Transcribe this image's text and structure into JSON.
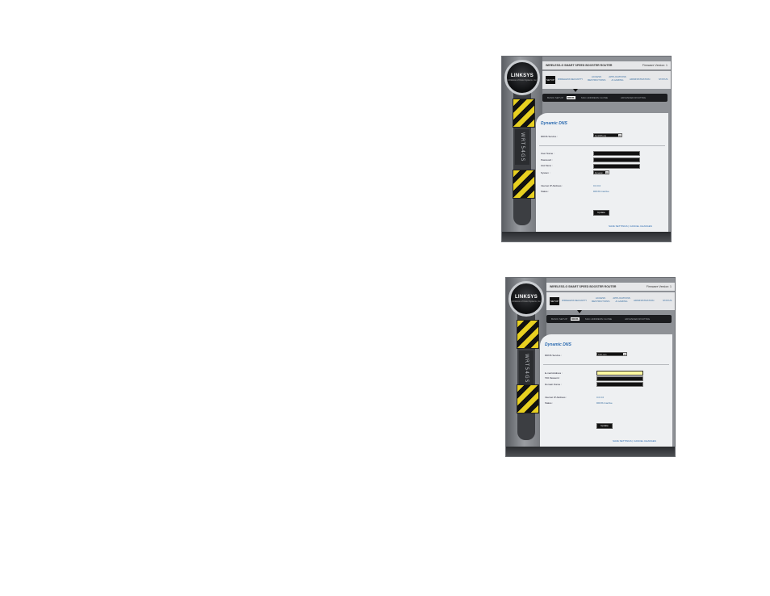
{
  "shots": [
    {
      "logo": {
        "brand": "LINKSYS",
        "tag": "A Division of Cisco Systems, Inc."
      },
      "rail_text": "WRT54GS",
      "header": {
        "product": "WIRELESS-G SMART SPEED BOOSTER ROUTER",
        "firmware": "Firmware Version: 1"
      },
      "tabs": {
        "active": "SETUP",
        "items": [
          "WIRELESS",
          "SECURITY",
          "ACCESS RESTRICTIONS",
          "APPLICATIONS & GAMING",
          "ADMINISTRATION",
          "STATUS"
        ]
      },
      "subnav": {
        "items": [
          "BASIC SETUP",
          "DDNS",
          "MAC ADDRESS CLONE",
          "ADVANCED ROUTING"
        ],
        "active_index": 1
      },
      "page": {
        "title": "Dynamic DNS",
        "service_label": "DDNS Service :",
        "service_value": "DynDNS.org",
        "fields": [
          {
            "label": "User Name :",
            "value": ""
          },
          {
            "label": "Password :",
            "value": ""
          },
          {
            "label": "Host Name :",
            "value": ""
          }
        ],
        "system_label": "System :",
        "system_value": "Dynamic",
        "ip_label": "Internet IP Address :",
        "ip_value": "0.0.0.0",
        "status_label": "Status :",
        "status_value": "DDNS Inactive",
        "update_button": "Update",
        "save": "SAVE SETTINGS",
        "cancel": "CANCEL CHANGES"
      }
    },
    {
      "logo": {
        "brand": "LINKSYS",
        "tag": "A Division of Cisco Systems, Inc."
      },
      "rail_text": "WRT54GS",
      "header": {
        "product": "WIRELESS-G SMART SPEED BOOSTER ROUTER",
        "firmware": "Firmware Version: 1"
      },
      "tabs": {
        "active": "SETUP",
        "items": [
          "WIRELESS",
          "SECURITY",
          "ACCESS RESTRICTIONS",
          "APPLICATIONS & GAMING",
          "ADMINISTRATION",
          "STATUS"
        ]
      },
      "subnav": {
        "items": [
          "BASIC SETUP",
          "DDNS",
          "MAC ADDRESS CLONE",
          "ADVANCED ROUTING"
        ],
        "active_index": 1
      },
      "page": {
        "title": "Dynamic DNS",
        "service_label": "DDNS Service :",
        "service_value": "TZO.com",
        "fields": [
          {
            "label": "E-mail Address :",
            "value": ""
          },
          {
            "label": "TZO Password :",
            "value": ""
          },
          {
            "label": "Domain Name :",
            "value": ""
          }
        ],
        "ip_label": "Internet IP Address :",
        "ip_value": "0.0.0.0",
        "status_label": "Status :",
        "status_value": "DDNS Inactive",
        "update_button": "Update",
        "save": "SAVE SETTINGS",
        "cancel": "CANCEL CHANGES"
      }
    }
  ]
}
